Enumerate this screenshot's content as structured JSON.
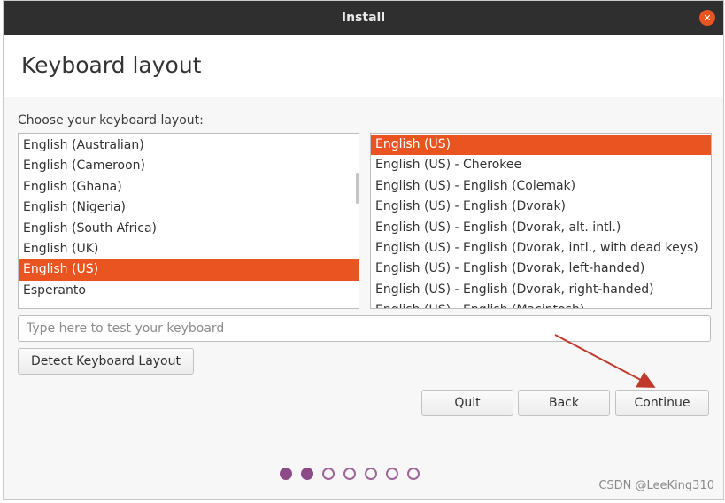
{
  "window": {
    "title": "Install",
    "close_icon": "close-icon",
    "accent_color": "#e95420"
  },
  "page": {
    "title": "Keyboard layout",
    "choose_label": "Choose your keyboard layout:"
  },
  "layouts": {
    "items": [
      {
        "label": "English (Australian)",
        "selected": false
      },
      {
        "label": "English (Cameroon)",
        "selected": false
      },
      {
        "label": "English (Ghana)",
        "selected": false
      },
      {
        "label": "English (Nigeria)",
        "selected": false
      },
      {
        "label": "English (South Africa)",
        "selected": false
      },
      {
        "label": "English (UK)",
        "selected": false
      },
      {
        "label": "English (US)",
        "selected": true
      },
      {
        "label": "Esperanto",
        "selected": false
      }
    ]
  },
  "variants": {
    "items": [
      {
        "label": "English (US)",
        "selected": true
      },
      {
        "label": "English (US) - Cherokee",
        "selected": false
      },
      {
        "label": "English (US) - English (Colemak)",
        "selected": false
      },
      {
        "label": "English (US) - English (Dvorak)",
        "selected": false
      },
      {
        "label": "English (US) - English (Dvorak, alt. intl.)",
        "selected": false
      },
      {
        "label": "English (US) - English (Dvorak, intl., with dead keys)",
        "selected": false
      },
      {
        "label": "English (US) - English (Dvorak, left-handed)",
        "selected": false
      },
      {
        "label": "English (US) - English (Dvorak, right-handed)",
        "selected": false
      },
      {
        "label": "English (US) - English (Macintosh)",
        "selected": false
      }
    ]
  },
  "test_input": {
    "placeholder": "Type here to test your keyboard",
    "value": ""
  },
  "buttons": {
    "detect": "Detect Keyboard Layout",
    "quit": "Quit",
    "back": "Back",
    "continue": "Continue"
  },
  "progress": {
    "current_step": 2,
    "total_steps": 7
  },
  "watermark": "CSDN @LeeKing310"
}
